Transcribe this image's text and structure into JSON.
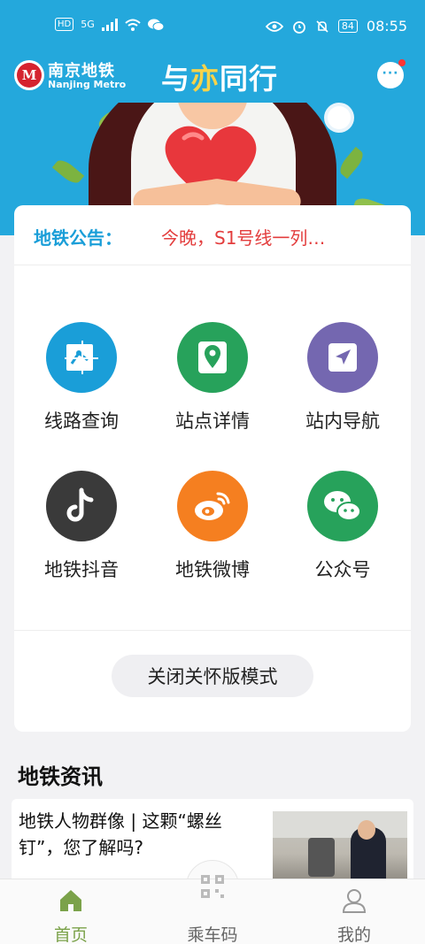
{
  "statusbar": {
    "left_badge": "HD",
    "network": "5G",
    "battery": "84",
    "time": "08:55"
  },
  "header": {
    "logo_char": "M",
    "brand_cn": "南京地铁",
    "brand_en": "Nanjing Metro",
    "slogan_part1": "与",
    "slogan_accent": "亦",
    "slogan_part2": "同行",
    "message_icon": "chat-bubble-icon"
  },
  "notice": {
    "label": "地铁公告：",
    "text": "今晚，S1号线一列…"
  },
  "shortcuts": [
    {
      "label": "线路查询",
      "icon": "route-map-icon",
      "color": "#1a9ed8"
    },
    {
      "label": "站点详情",
      "icon": "location-pin-icon",
      "color": "#27a25b"
    },
    {
      "label": "站内导航",
      "icon": "navigation-arrow-icon",
      "color": "#7467b0"
    },
    {
      "label": "地铁抖音",
      "icon": "tiktok-icon",
      "color": "#3a3a3a"
    },
    {
      "label": "地铁微博",
      "icon": "weibo-icon",
      "color": "#f57f20"
    },
    {
      "label": "公众号",
      "icon": "wechat-icon",
      "color": "#27a25b"
    }
  ],
  "mode_button": {
    "label": "关闭关怀版模式"
  },
  "news": {
    "section_title": "地铁资讯",
    "items": [
      {
        "title": "地铁人物群像 | 这颗“螺丝钉”，您了解吗?"
      }
    ]
  },
  "tabbar": {
    "tabs": [
      {
        "label": "首页",
        "icon": "home-icon"
      },
      {
        "label": "乘车码",
        "icon": "qr-code-icon"
      },
      {
        "label": "我的",
        "icon": "user-icon"
      }
    ],
    "active_color": "#7ba24a"
  }
}
